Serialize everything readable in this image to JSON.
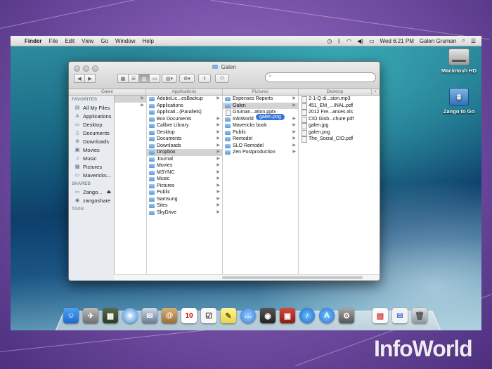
{
  "menubar": {
    "items": [
      "Finder",
      "File",
      "Edit",
      "View",
      "Go",
      "Window",
      "Help"
    ],
    "clock": "Wed 6:21 PM",
    "user": "Galen Gruman"
  },
  "desktop": {
    "icons": [
      "Macintosh HD",
      "Zango to Go"
    ]
  },
  "window": {
    "title": "Galen",
    "search_placeholder": "",
    "column_headers": [
      "Galen",
      "Applications",
      "Pictures",
      "Desktop"
    ]
  },
  "sidebar": {
    "favorites_heading": "FAVORITES",
    "favorites": [
      "All My Files",
      "Applications",
      "Desktop",
      "Documents",
      "Downloads",
      "Movies",
      "Music",
      "Pictures",
      "Mavericks..."
    ],
    "shared_heading": "SHARED",
    "shared": [
      "Zango...",
      "zangoshare"
    ],
    "tags_heading": "TAGS"
  },
  "columns": {
    "galen": [],
    "applications": [
      "AdobeLic...esBackup",
      "Applications",
      "Applicati...(Parallels)",
      "Box Documents",
      "Calibre Library",
      "Desktop",
      "Documents",
      "Downloads",
      "Dropbox",
      "Journal",
      "Movies",
      "MSYNC",
      "Music",
      "Pictures",
      "Public",
      "Samsung",
      "Sites",
      "SkyDrive"
    ],
    "pictures": [
      "Expenses Reports",
      "Galen",
      "Gruman...ation.pptx",
      "InfoWorld",
      "Mavericks book",
      "Public",
      "Remodel",
      "SLO Remodel",
      "Zen Postproduction"
    ],
    "desktop": [
      "2-1-Q di...sion.mp3",
      "451_EM_...INAL.pdf",
      "2012 Fre...ances.xls",
      "CIO Glob...chure.pdf",
      "galen.jpg",
      "galen.png",
      "The_Social_CIO.pdf"
    ]
  },
  "drag_label": "galen.png",
  "calendar_day": "10",
  "watermark": "InfoWorld"
}
